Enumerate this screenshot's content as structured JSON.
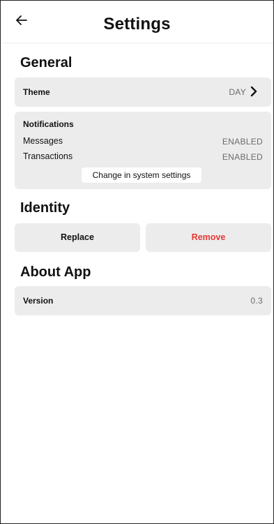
{
  "header": {
    "title": "Settings",
    "back_icon": "arrow-left-icon"
  },
  "sections": {
    "general": {
      "title": "General",
      "theme": {
        "label": "Theme",
        "value": "DAY",
        "chevron_icon": "chevron-right-icon"
      },
      "notifications": {
        "label": "Notifications",
        "items": [
          {
            "label": "Messages",
            "value": "ENABLED"
          },
          {
            "label": "Transactions",
            "value": "ENABLED"
          }
        ],
        "system_button": "Change in system settings"
      }
    },
    "identity": {
      "title": "Identity",
      "replace_label": "Replace",
      "remove_label": "Remove",
      "remove_color": "#e53935"
    },
    "about": {
      "title": "About App",
      "version_label": "Version",
      "version_value": "0.3"
    }
  }
}
